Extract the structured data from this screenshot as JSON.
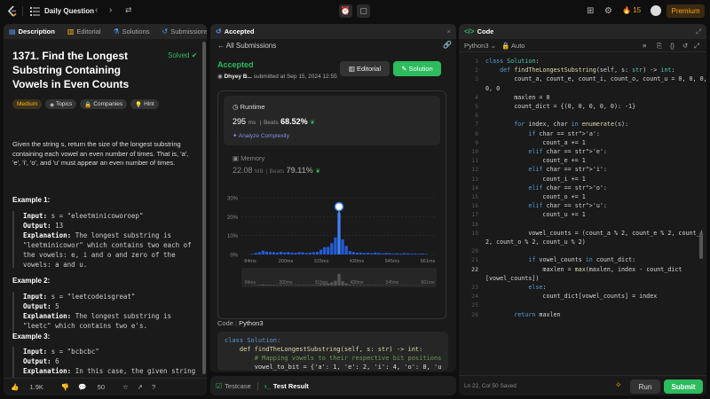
{
  "topbar": {
    "title": "Daily Question",
    "streak": "15",
    "premium": "Premium"
  },
  "left": {
    "tabs": [
      "Description",
      "Editorial",
      "Solutions",
      "Submissions"
    ],
    "problem_title": "1371. Find the Longest Substring Containing Vowels in Even Counts",
    "solved": "Solved",
    "chips": [
      "Medium",
      "Topics",
      "Companies",
      "Hint"
    ],
    "description": "Given the string s, return the size of the longest substring containing each vowel an even number of times. That is, 'a', 'e', 'i', 'o', and 'u' must appear an even number of times.",
    "examples": [
      {
        "title": "Example 1:",
        "input": "s = \"eleetminicoworoep\"",
        "output": "13",
        "explanation": "The longest substring is \"leetminicowor\" which contains two each of the vowels: e, i and o and zero of the vowels: a and u."
      },
      {
        "title": "Example 2:",
        "input": "s = \"leetcodeisgreat\"",
        "output": "5",
        "explanation": "The longest substring is \"leetc\" which contains two e's."
      },
      {
        "title": "Example 3:",
        "input": "s = \"bcbcbc\"",
        "output": "6",
        "explanation": "In this case, the given string \"bcbcbc\" is the longest because all vowels: a, e, i, o and u appear zero times."
      }
    ],
    "likes": "1.9K",
    "comments": "50"
  },
  "mid": {
    "tabs": [
      "Accepted"
    ],
    "all_submissions": "All Submissions",
    "status": "Accepted",
    "user": "Dhyey B...",
    "submitted": "submitted at Sep 15, 2024 12:55",
    "editorial": "Editorial",
    "solution": "Solution",
    "runtime_label": "Runtime",
    "runtime_value": "295",
    "runtime_unit": "ms",
    "runtime_beats_label": "Beats",
    "runtime_beats": "68.52%",
    "analyze": "Analyze Complexity",
    "memory_label": "Memory",
    "memory_value": "22.08",
    "memory_unit": "MB",
    "memory_beats_label": "Beats",
    "memory_beats": "79.11%",
    "code_label": "Code",
    "code_lang": "Python3",
    "code_lines": [
      "class Solution:",
      "    def findTheLongestSubstring(self, s: str) -> int:",
      "        # Mapping vowels to their respective bit positions",
      "        vowel_to_bit = {'a': 1, 'e': 2, 'i': 4, 'o': 8, 'u"
    ]
  },
  "chart_data": {
    "type": "bar",
    "y_ticks": [
      "30%",
      "20%",
      "10%",
      "0%"
    ],
    "x_ticks": [
      "84ms",
      "200ms",
      "315ms",
      "430ms",
      "545ms",
      "661ms"
    ],
    "highlight_index": 24,
    "values": [
      0.3,
      0.8,
      1.2,
      2.0,
      1.5,
      1.3,
      1.2,
      1.0,
      1.4,
      1.1,
      1.3,
      1.0,
      0.9,
      1.2,
      1.1,
      0.8,
      1.0,
      1.2,
      1.4,
      2.5,
      3.8,
      4.0,
      6.0,
      9.0,
      22.0,
      8.0,
      4.5,
      1.8,
      1.3,
      0.9,
      1.0,
      0.8,
      0.9,
      0.7,
      1.0,
      0.8,
      0.6,
      0.8,
      0.7,
      0.5,
      0.6,
      0.5,
      0.7,
      0.6,
      0.4,
      0.5,
      0.4,
      0.5,
      0.3
    ],
    "ylim": [
      0,
      30
    ]
  },
  "tests": {
    "tabs": [
      "Testcase",
      "Test Result"
    ]
  },
  "right": {
    "tab": "Code",
    "lang": "Python3",
    "auto": "Auto",
    "status": "Ln 22, Col 50   Saved",
    "run": "Run",
    "submit": "Submit",
    "code": [
      {
        "n": "1",
        "t": "class Solution:"
      },
      {
        "n": "2",
        "t": "    def findTheLongestSubstring(self, s: str) -> int:"
      },
      {
        "n": "3",
        "t": "        count_a, count_e, count_i, count_o, count_u = 0, 0, 0,"
      },
      {
        "n": "",
        "t": "0, 0"
      },
      {
        "n": "4",
        "t": "        maxlen = 0"
      },
      {
        "n": "5",
        "t": "        count_dict = {(0, 0, 0, 0, 0): -1}"
      },
      {
        "n": "6",
        "t": ""
      },
      {
        "n": "7",
        "t": "        for index, char in enumerate(s):"
      },
      {
        "n": "8",
        "t": "            if char == 'a':"
      },
      {
        "n": "9",
        "t": "                count_a += 1"
      },
      {
        "n": "10",
        "t": "            elif char == 'e':"
      },
      {
        "n": "11",
        "t": "                count_e += 1"
      },
      {
        "n": "12",
        "t": "            elif char == 'i':"
      },
      {
        "n": "13",
        "t": "                count_i += 1"
      },
      {
        "n": "14",
        "t": "            elif char == 'o':"
      },
      {
        "n": "15",
        "t": "                count_o += 1"
      },
      {
        "n": "16",
        "t": "            elif char == 'u':"
      },
      {
        "n": "17",
        "t": "                count_u += 1"
      },
      {
        "n": "18",
        "t": ""
      },
      {
        "n": "19",
        "t": "            vowel_counts = (count_a % 2, count_e % 2, count_i %"
      },
      {
        "n": "",
        "t": "2, count_o % 2, count_u % 2)"
      },
      {
        "n": "20",
        "t": ""
      },
      {
        "n": "21",
        "t": "            if vowel_counts in count_dict:"
      },
      {
        "n": "22",
        "t": "                maxlen = max(maxlen, index - count_dict"
      },
      {
        "n": "",
        "t": "[vowel_counts])"
      },
      {
        "n": "23",
        "t": "            else:"
      },
      {
        "n": "24",
        "t": "                count_dict[vowel_counts] = index"
      },
      {
        "n": "25",
        "t": ""
      },
      {
        "n": "26",
        "t": "        return maxlen"
      }
    ]
  }
}
